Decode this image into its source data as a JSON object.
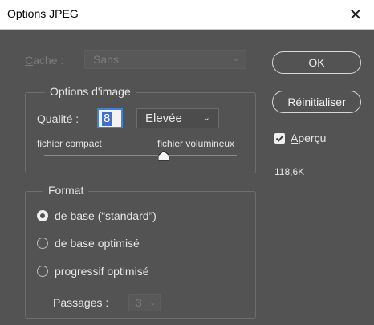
{
  "window": {
    "title": "Options JPEG",
    "close_glyph": "✕"
  },
  "cache": {
    "label_first": "C",
    "label_rest": "ache :",
    "value": "Sans"
  },
  "image_options": {
    "legend": "Options d'image",
    "quality_label": "Qualité :",
    "quality_value": "8",
    "quality_level": "Elevée",
    "compact_label": "fichier compact",
    "large_label": "fichier volumineux",
    "slider_fraction": 0.62
  },
  "format": {
    "legend": "Format",
    "options": [
      {
        "label": "de base (“standard”)",
        "checked": true
      },
      {
        "label": "de base optimisé",
        "checked": false
      },
      {
        "label": "progressif optimisé",
        "checked": false
      }
    ],
    "passes_label": "Passages :",
    "passes_value": "3"
  },
  "buttons": {
    "ok": "OK",
    "reset": "Réinitialiser"
  },
  "preview": {
    "label_first": "A",
    "label_rest": "perçu",
    "checked": true
  },
  "file_size": "118,6K",
  "icons": {
    "close": "close-icon",
    "chevron": "chevron-down-icon",
    "check": "checkmark-icon"
  }
}
